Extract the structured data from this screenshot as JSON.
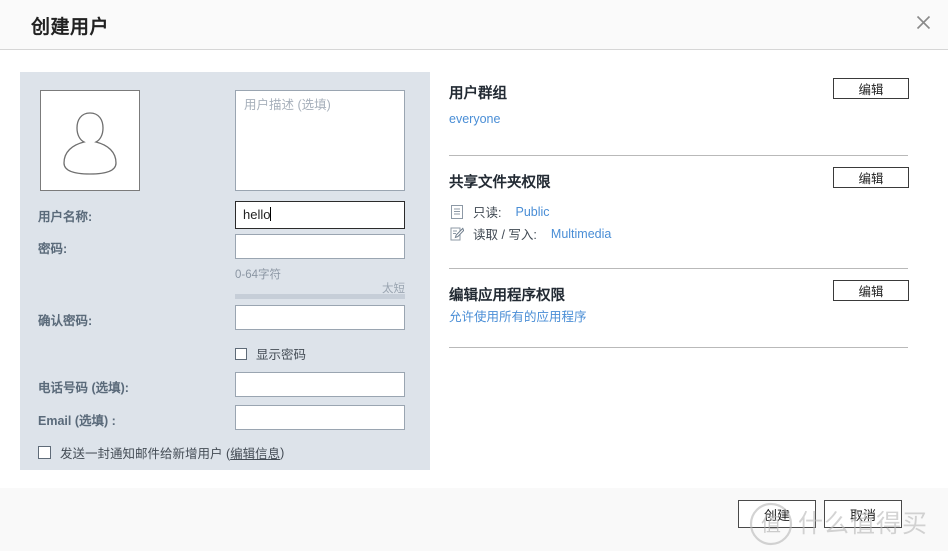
{
  "dialog": {
    "title": "创建用户",
    "close_icon": "close-icon"
  },
  "left_form": {
    "avatar_icon": "user-avatar-icon",
    "description": {
      "placeholder": "用户描述 (选填)",
      "value": ""
    },
    "fields": [
      {
        "label": "用户名称:",
        "value": "hello",
        "placeholder": "",
        "focused": true
      },
      {
        "label": "密码:",
        "value": "",
        "placeholder": "",
        "focused": false
      },
      {
        "label": "确认密码:",
        "value": "",
        "placeholder": "",
        "focused": false
      },
      {
        "label": "电话号码 (选填):",
        "value": "",
        "placeholder": "",
        "focused": false
      },
      {
        "label": "Email  (选填) :",
        "value": "",
        "placeholder": "",
        "focused": false
      }
    ],
    "password_hint": "0-64字符",
    "password_strength_label": "太短",
    "show_password": {
      "label": "显示密码",
      "checked": false
    },
    "notify_mail": {
      "label_before": "发送一封通知邮件给新增用户 (",
      "link": "编辑信息",
      "label_after": ")",
      "checked": false
    }
  },
  "right_panel": {
    "sections": [
      {
        "title": "用户群组",
        "edit_label": "编辑",
        "links": [
          "everyone"
        ]
      },
      {
        "title": "共享文件夹权限",
        "edit_label": "编辑",
        "permissions": [
          {
            "icon": "read-only-icon",
            "label": "只读:",
            "value": "Public"
          },
          {
            "icon": "read-write-icon",
            "label": "读取 / 写入:",
            "value": "Multimedia"
          }
        ]
      },
      {
        "title": "编辑应用程序权限",
        "edit_label": "编辑",
        "links": [
          "允许使用所有的应用程序"
        ]
      }
    ]
  },
  "footer": {
    "create_label": "创建",
    "cancel_label": "取消"
  },
  "watermark": {
    "text": "什么值得买",
    "logo_text": "值"
  },
  "colors": {
    "panel_bg": "#dde3ea",
    "link_blue": "#4a8ed6",
    "header_bg": "#fafafa",
    "footer_bg": "#f9f9f9",
    "strength_bar": "#c6ced8"
  }
}
